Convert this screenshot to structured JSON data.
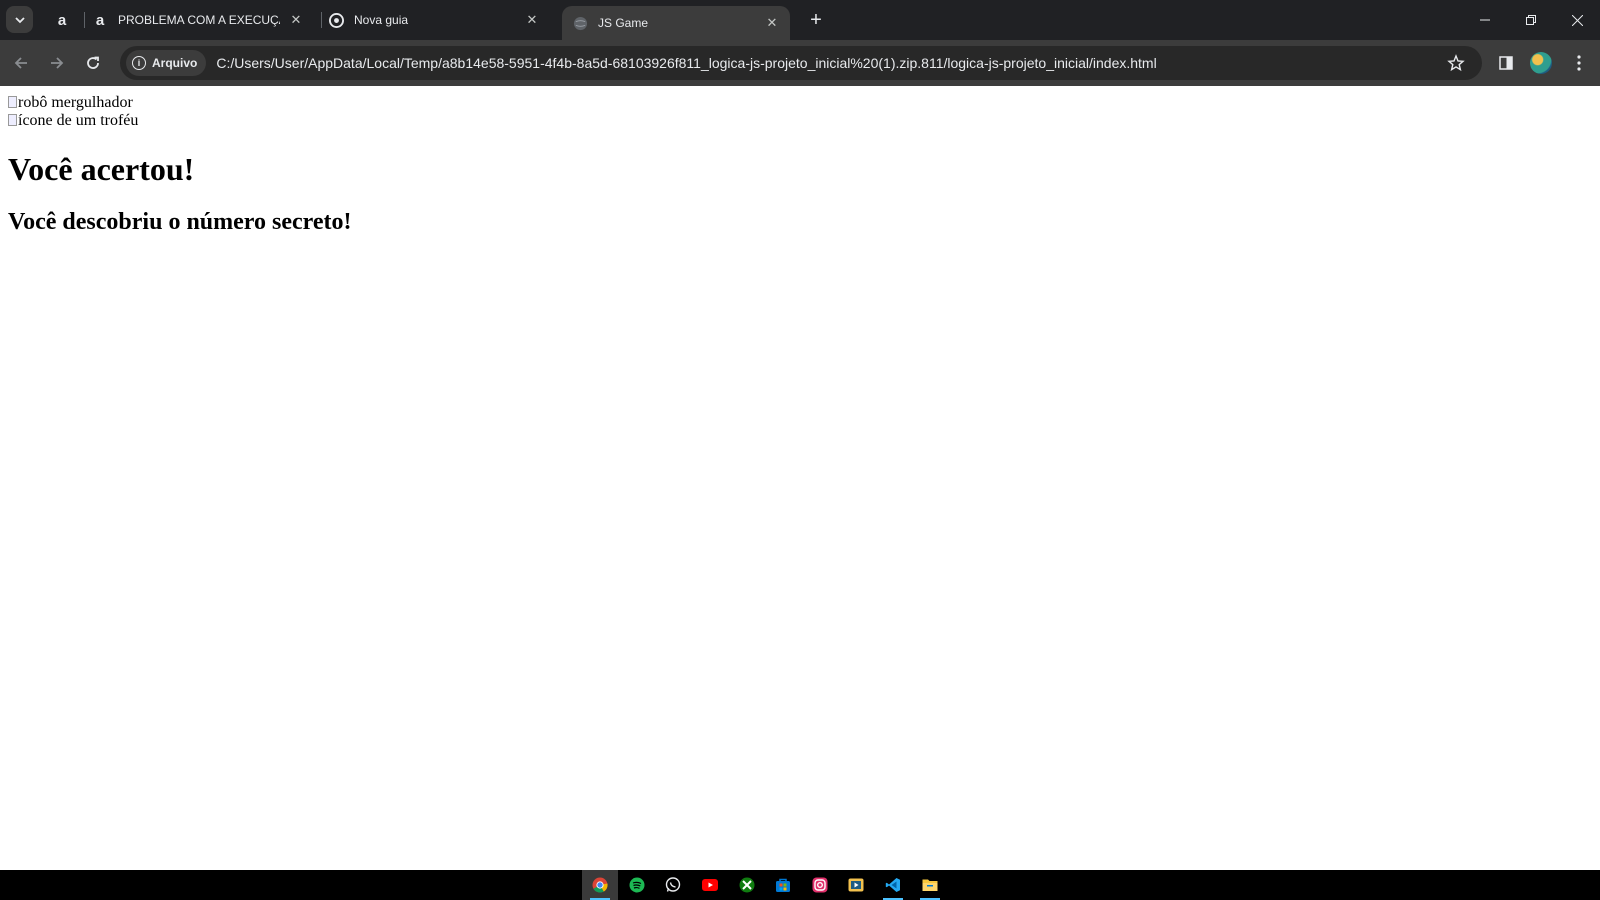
{
  "browser": {
    "tabs": [
      {
        "title": "",
        "favicon": "alura-icon",
        "pinned": true
      },
      {
        "title": "PROBLEMA COM A EXECUÇÃO",
        "favicon": "alura-icon"
      },
      {
        "title": "Nova guia",
        "favicon": "chrome-icon"
      },
      {
        "title": "JS Game",
        "favicon": "globe-icon",
        "active": true
      }
    ],
    "new_tab_symbol": "+",
    "address": {
      "chip_label": "Arquivo",
      "url": "C:/Users/User/AppData/Local/Temp/a8b14e58-5951-4f4b-8a5d-68103926f811_logica-js-projeto_inicial%20(1).zip.811/logica-js-projeto_inicial/index.html"
    },
    "window_controls": [
      "minimize",
      "restore",
      "close"
    ]
  },
  "page": {
    "images": [
      {
        "alt": "robô mergulhador"
      },
      {
        "alt": "ícone de um troféu"
      }
    ],
    "heading": "Você acertou!",
    "subheading": "Você descobriu o número secreto!"
  },
  "taskbar": {
    "apps": [
      {
        "name": "chrome-icon",
        "active": true,
        "color": "#4285f4"
      },
      {
        "name": "spotify-icon",
        "color": "#1db954"
      },
      {
        "name": "whatsapp-icon",
        "color": "#25d366"
      },
      {
        "name": "youtube-icon",
        "color": "#ff0000"
      },
      {
        "name": "xbox-icon",
        "color": "#107c10"
      },
      {
        "name": "microsoft-store-icon",
        "color": "#0078d4"
      },
      {
        "name": "instagram-icon",
        "color": "#e1306c"
      },
      {
        "name": "media-player-icon",
        "color": "#f2c14e"
      },
      {
        "name": "vscode-icon",
        "color": "#23a9f2"
      },
      {
        "name": "file-explorer-icon",
        "color": "#f8c73e"
      }
    ]
  }
}
